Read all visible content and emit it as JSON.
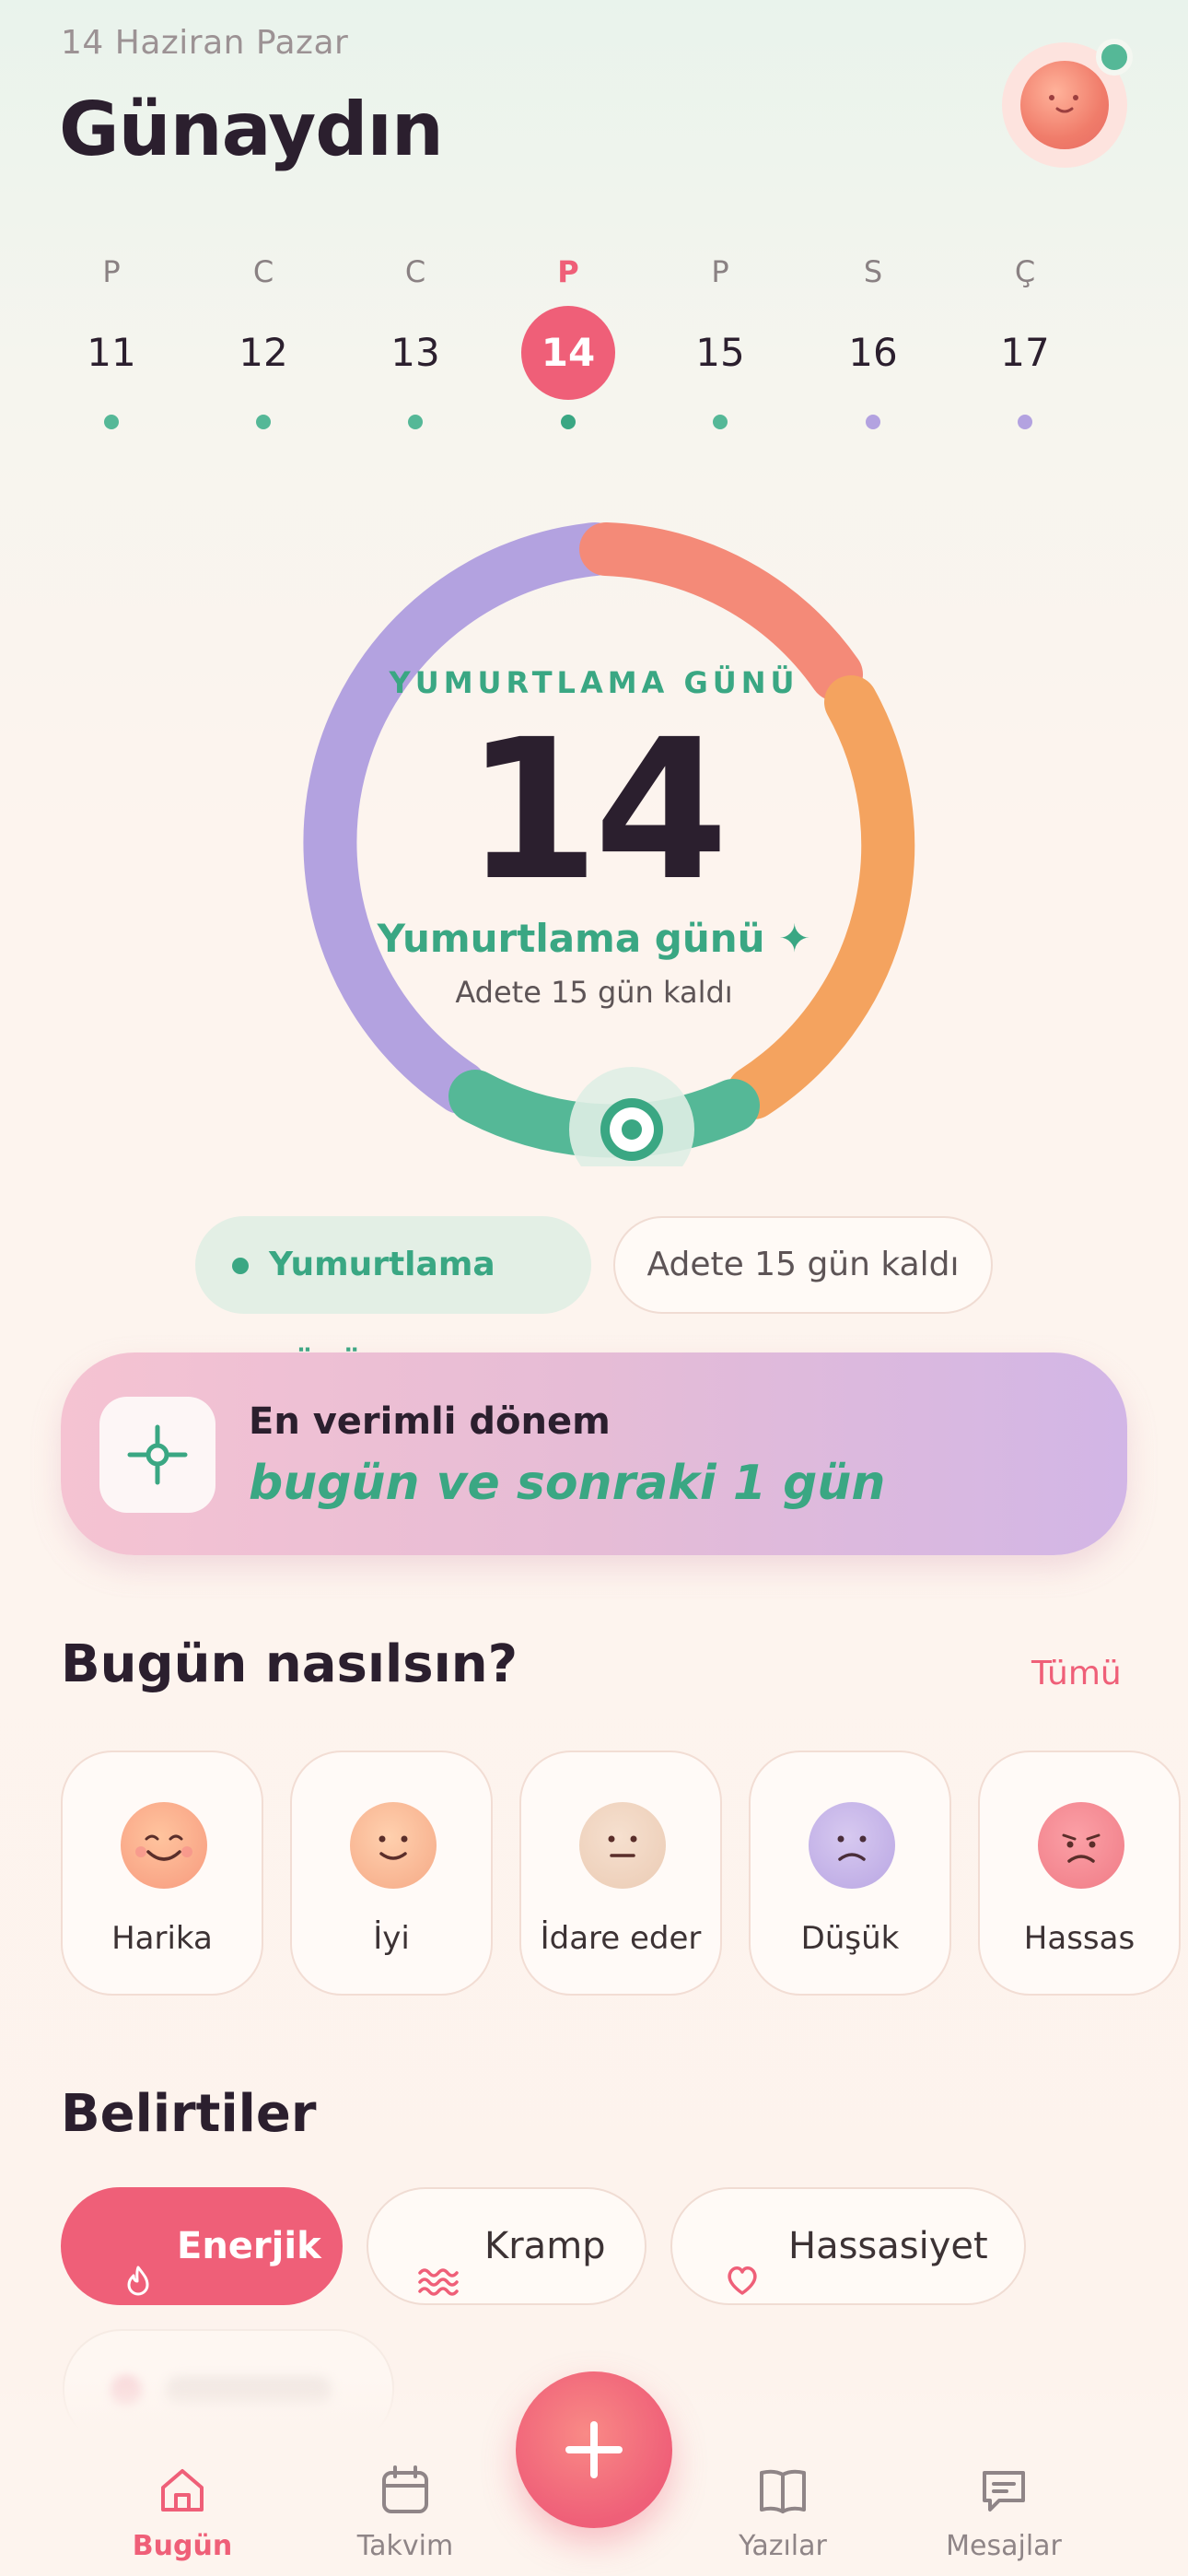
{
  "header": {
    "date": "14 Haziran Pazar",
    "greeting": "Günaydın"
  },
  "week": [
    {
      "letter": "P",
      "num": "11",
      "dot": "#55b897",
      "selected": false
    },
    {
      "letter": "C",
      "num": "12",
      "dot": "#55b897",
      "selected": false
    },
    {
      "letter": "C",
      "num": "13",
      "dot": "#55b897",
      "selected": false
    },
    {
      "letter": "P",
      "num": "14",
      "dot": "#3aa783",
      "selected": true
    },
    {
      "letter": "P",
      "num": "15",
      "dot": "#55b897",
      "selected": false
    },
    {
      "letter": "S",
      "num": "16",
      "dot": "#b3a2e0",
      "selected": false
    },
    {
      "letter": "Ç",
      "num": "17",
      "dot": "#b3a2e0",
      "selected": false
    }
  ],
  "cycle": {
    "label": "YUMURTLAMA GÜNÜ",
    "day": "14",
    "status": "Yumurtlama günü ✦",
    "countdown": "Adete 15 gün kaldı"
  },
  "pills": {
    "phase": "Yumurtlama günü",
    "countdown": "Adete 15 gün kaldı"
  },
  "fertile": {
    "title": "En verimli dönem",
    "range": "bugün ve sonraki 1 gün"
  },
  "mood": {
    "title": "Bugün nasılsın?",
    "all_link": "Tümü",
    "items": [
      {
        "label": "Harika",
        "icon": "grin-face-icon"
      },
      {
        "label": "İyi",
        "icon": "smile-face-icon"
      },
      {
        "label": "İdare eder",
        "icon": "neutral-face-icon"
      },
      {
        "label": "Düşük",
        "icon": "sad-face-icon"
      },
      {
        "label": "Hassas",
        "icon": "upset-face-icon"
      }
    ]
  },
  "symptoms": {
    "title": "Belirtiler",
    "items": [
      {
        "label": "Enerjik",
        "icon": "flame-icon",
        "active": true
      },
      {
        "label": "Kramp",
        "icon": "waves-icon",
        "active": false
      },
      {
        "label": "Hassasiyet",
        "icon": "heart-icon",
        "active": false
      }
    ]
  },
  "nav": {
    "items": [
      {
        "label": "Bugün",
        "icon": "home-icon",
        "active": true
      },
      {
        "label": "Takvim",
        "icon": "calendar-icon",
        "active": false
      },
      {
        "label": "Yazılar",
        "icon": "book-icon",
        "active": false
      },
      {
        "label": "Mesajlar",
        "icon": "message-icon",
        "active": false
      }
    ],
    "fab_icon": "plus-icon"
  },
  "colors": {
    "accent": "#ef5f78",
    "green": "#3aa783",
    "lavender": "#b3a2e0",
    "coral": "#f48a78",
    "orange": "#f4a35f"
  }
}
